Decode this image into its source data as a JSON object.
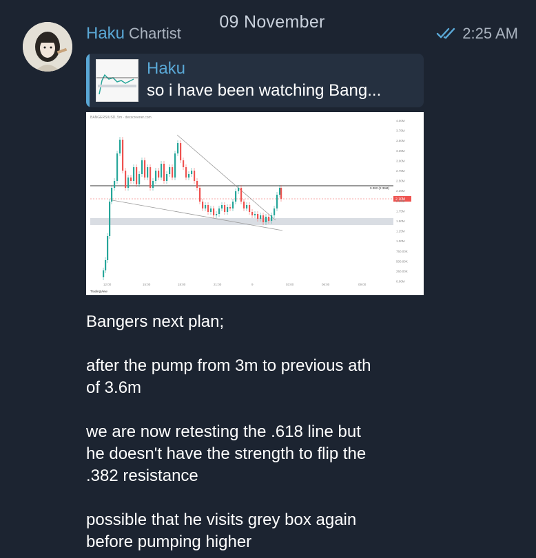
{
  "date_header": "09 November",
  "message": {
    "sender_name": "Haku",
    "sender_role": "Chartist",
    "time": "2:25 AM",
    "read_status_icon": "double-check-icon",
    "reply": {
      "name": "Haku",
      "text": "so i have been watching Bang..."
    },
    "chart_image": {
      "header_text": "BANGERS/USD, 5m · dexscreener.com",
      "fib_label": "0.382 (2.39M)",
      "price_badge": "2.10M",
      "watermark": "TradingView",
      "y_ticks": [
        "4.00M",
        "3.75M",
        "3.50M",
        "3.25M",
        "3.00M",
        "2.75M",
        "2.50M",
        "2.25M",
        "2.00M",
        "1.75M",
        "1.50M",
        "1.25M",
        "1.00M",
        "750.00K",
        "500.00K",
        "250.00K",
        "0.00M"
      ],
      "x_ticks": [
        "12:00",
        "15:00",
        "18:00",
        "21:00",
        "9",
        "03:00",
        "06:00",
        "09:00"
      ]
    },
    "lines": [
      "Bangers next plan;",
      "",
      "after the pump from 3m to previous ath",
      "of 3.6m",
      "",
      "we are now retesting the .618 line but",
      "he doesn't have the strength to flip the",
      ".382 resistance",
      "",
      "possible that he visits grey box again",
      "before pumping higher"
    ]
  },
  "colors": {
    "background": "#1c2431",
    "accent": "#5aa8d6",
    "candle_up": "#26a69a",
    "candle_down": "#ef5350"
  }
}
